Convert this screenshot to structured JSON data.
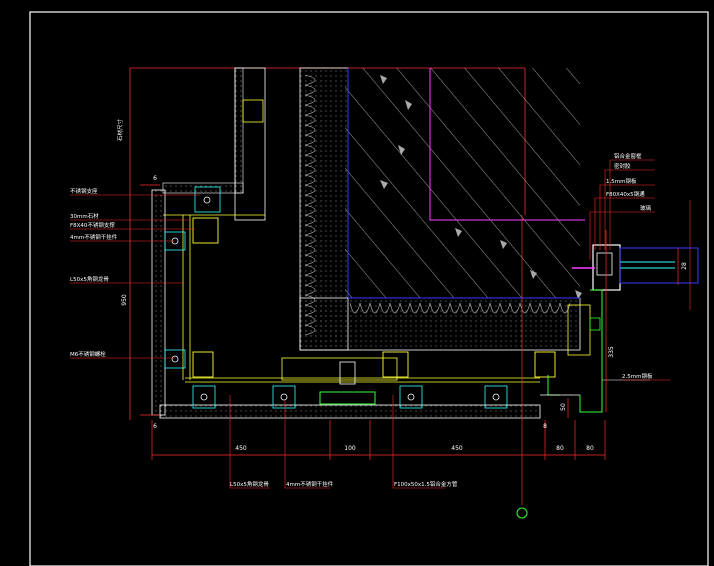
{
  "drawing": {
    "background_color": "#000000",
    "colors": {
      "border": "#ffffff",
      "dimension": "#ff2b2b",
      "profile": "#ffffff",
      "hatch": "#c8c8c8",
      "structure_edge": "#ff40ff",
      "insulation_line": "#3a3aff",
      "detail_yellow": "#ffff33",
      "detail_green": "#33ff33",
      "detail_cyan": "#33ffff",
      "label_text": "#ffffff"
    },
    "left_labels": [
      "不锈钢支座",
      "30mm石材",
      "F8X40不锈钢支撑",
      "4mm不锈钢干挂件",
      "L50x5角钢龙骨",
      "M6不锈钢螺栓"
    ],
    "vertical_label": "石材尺寸",
    "right_labels": [
      "铝合金窗框",
      "密封胶",
      "1.5mm钢板",
      "F80X40x5钢通",
      "玻璃",
      "2.5mm钢板"
    ],
    "bottom_labels": [
      "L50x5角钢龙骨",
      "4mm不锈钢干挂件",
      "F100x50x1.5铝合金方管"
    ],
    "dimensions": {
      "bottom": [
        "450",
        "100",
        "450",
        "80",
        "80"
      ],
      "left": "950",
      "right_lower": "335",
      "right_small": "50",
      "right_window": "28",
      "marks": [
        "6",
        "6",
        "8"
      ]
    }
  }
}
